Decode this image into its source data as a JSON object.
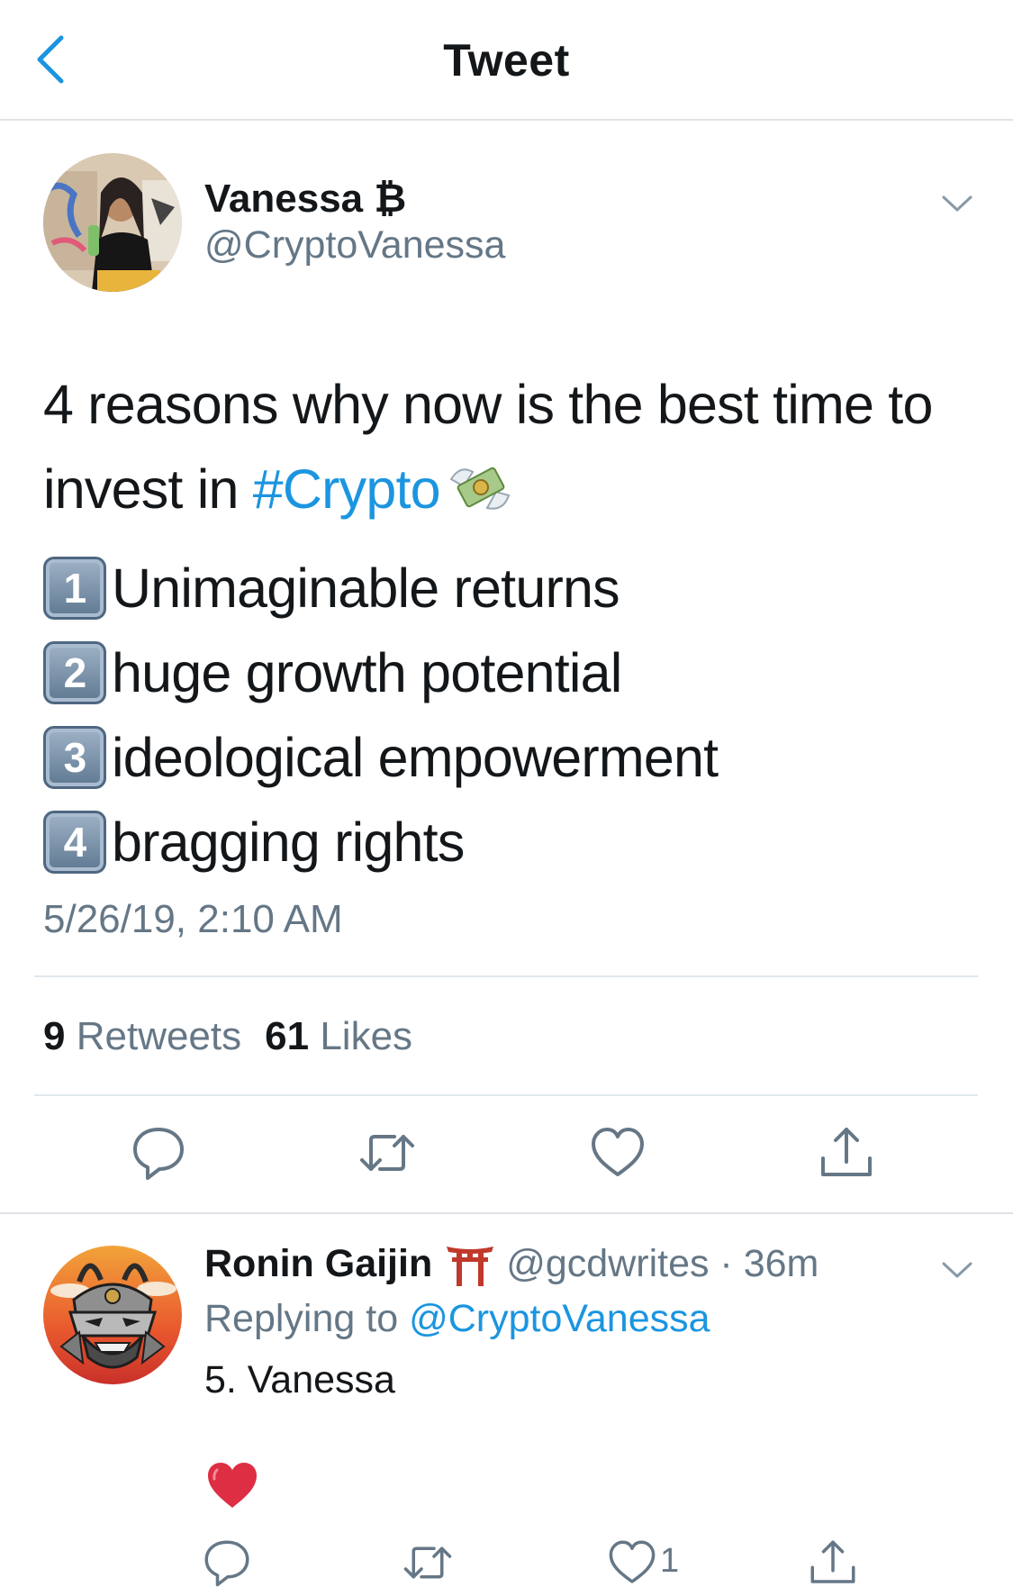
{
  "header": {
    "title": "Tweet"
  },
  "tweet": {
    "author_name": "Vanessa ₿",
    "author_handle": "@CryptoVanessa",
    "text_main": "4 reasons why now is the best time to invest in ",
    "hashtag": "#Crypto",
    "emoji": "money-with-wings",
    "reasons": [
      {
        "num": "1",
        "text": "Unimaginable returns"
      },
      {
        "num": "2",
        "text": "huge growth potential"
      },
      {
        "num": "3",
        "text": "ideological empowerment"
      },
      {
        "num": "4",
        "text": "bragging rights"
      }
    ],
    "timestamp": "5/26/19, 2:10 AM",
    "retweets_count": "9",
    "retweets_label": "Retweets",
    "likes_count": "61",
    "likes_label": "Likes"
  },
  "reply": {
    "author_name": "Ronin Gaijin",
    "author_emoji": "shinto-shrine",
    "handle_time": "@gcdwrites · 36m",
    "replying_label": "Replying to ",
    "replying_to": "@CryptoVanessa",
    "text": "5. Vanessa",
    "emoji": "red-heart",
    "like_count": "1"
  },
  "colors": {
    "accent": "#1b95e0",
    "muted": "#657786",
    "text": "#14171a",
    "divider": "#e1e8ed"
  },
  "icons": [
    "back-chevron-icon",
    "chevron-down-icon",
    "reply-icon",
    "retweet-icon",
    "like-icon",
    "share-icon"
  ]
}
